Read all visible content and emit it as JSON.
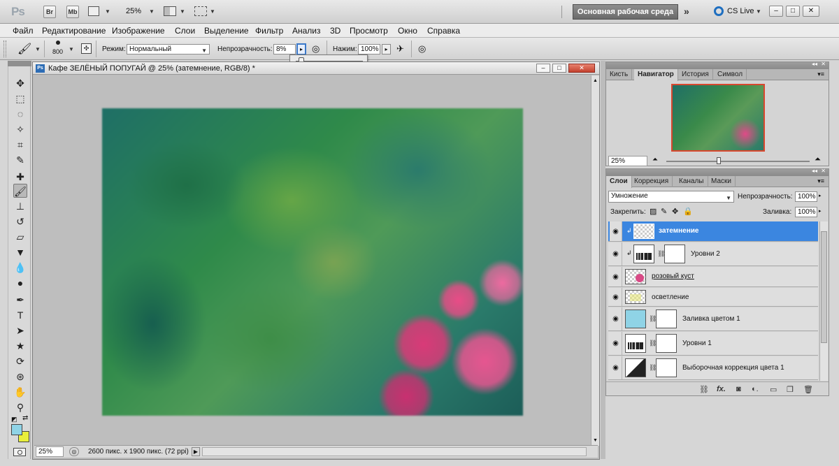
{
  "app": {
    "logo": "Ps",
    "bridge_label": "Br",
    "minibridge_label": "Mb",
    "zoom": "25%",
    "workspace": "Основная рабочая среда",
    "cs_live": "CS Live",
    "more": "»"
  },
  "menu": [
    "Файл",
    "Редактирование",
    "Изображение",
    "Слои",
    "Выделение",
    "Фильтр",
    "Анализ",
    "3D",
    "Просмотр",
    "Окно",
    "Справка"
  ],
  "options": {
    "brush_size": "800",
    "mode_label": "Режим:",
    "mode_value": "Нормальный",
    "opacity_label": "Непрозрачность:",
    "opacity_value": "8%",
    "flow_label": "Нажим:",
    "flow_value": "100%",
    "opacity_slider_fraction": 0.08
  },
  "document": {
    "title": "Кафе ЗЕЛЁНЫЙ ПОПУГАЙ @ 25% (затемнение, RGB/8) *",
    "zoom": "25%",
    "info": "2600 пикс. x 1900 пикс. (72 ppi)"
  },
  "navigator": {
    "tabs": [
      "Кисть",
      "Навигатор",
      "История",
      "Символ"
    ],
    "active_tab": "Навигатор",
    "zoom": "25%"
  },
  "layers": {
    "tabs": [
      "Слои",
      "Коррекция",
      "Каналы",
      "Маски"
    ],
    "active_tab": "Слои",
    "blend_mode": "Умножение",
    "opacity_label": "Непрозрачность:",
    "opacity_value": "100%",
    "lock_label": "Закрепить:",
    "fill_label": "Заливка:",
    "fill_value": "100%",
    "items": [
      {
        "name": "затемнение",
        "selected": true,
        "kind": "checker"
      },
      {
        "name": "Уровни 2",
        "selected": false,
        "kind": "levels"
      },
      {
        "name": "розовый куст",
        "selected": false,
        "kind": "image"
      },
      {
        "name": "осветление",
        "selected": false,
        "kind": "checker"
      },
      {
        "name": "Заливка цветом 1",
        "selected": false,
        "kind": "fill"
      },
      {
        "name": "Уровни 1",
        "selected": false,
        "kind": "levels"
      },
      {
        "name": "Выборочная коррекция цвета 1",
        "selected": false,
        "kind": "selective"
      }
    ]
  },
  "colors": {
    "foreground": "#8fd3e6",
    "background": "#e8ef3c",
    "selection": "#3b86e0"
  }
}
